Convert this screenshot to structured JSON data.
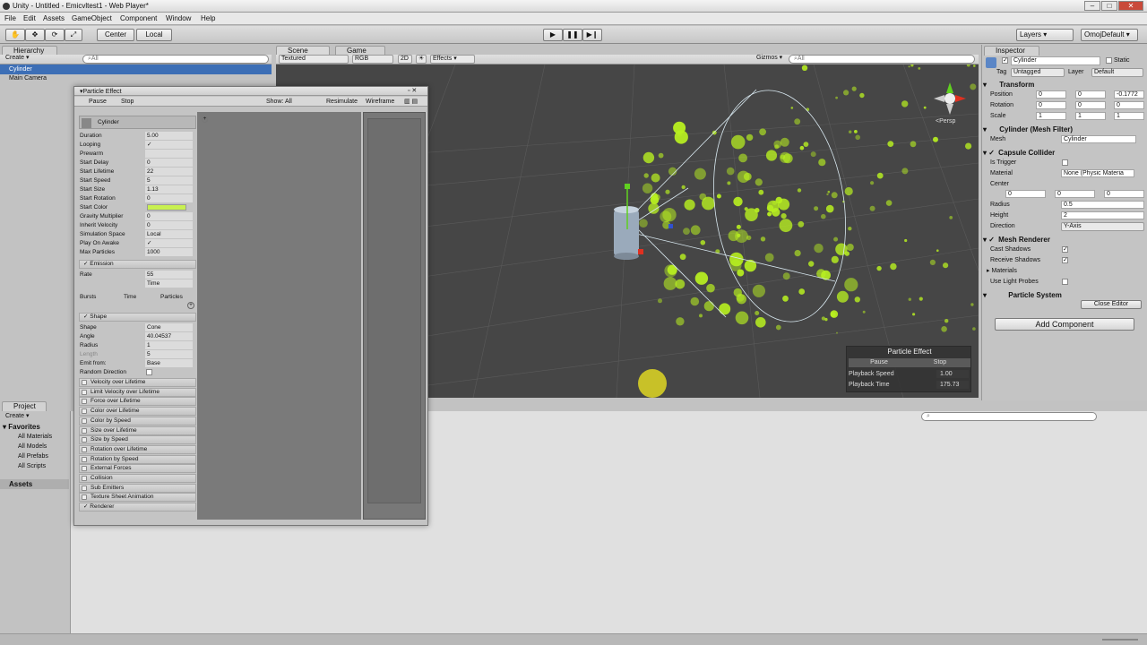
{
  "window": {
    "title": "Unity - Untitled - Emicvltest1 - Web Player*"
  },
  "menu": [
    "File",
    "Edit",
    "Assets",
    "GameObject",
    "Component",
    "Window",
    "Help"
  ],
  "toolbar": {
    "pivot": "Center",
    "space": "Local",
    "layers": "Layers",
    "layout": "OmojDefault"
  },
  "hierarchy": {
    "tab": "Hierarchy",
    "create": "Create",
    "search": "All",
    "items": [
      "Cylinder",
      "Main Camera"
    ]
  },
  "scene": {
    "tab_scene": "Scene",
    "tab_game": "Game",
    "render": "Textured",
    "color": "RGB",
    "mode2d": "2D",
    "effects": "Effects",
    "gizmos": "Gizmos",
    "search": "All",
    "persp": "Persp"
  },
  "overlay": {
    "title": "Particle Effect",
    "pause": "Pause",
    "stop": "Stop",
    "speed_label": "Playback Speed",
    "speed": "1.00",
    "time_label": "Playback Time",
    "time": "175.73"
  },
  "particle_effect": {
    "title": "Particle Effect",
    "pause": "Pause",
    "stop": "Stop",
    "show": "Show: All",
    "resimulate": "Resimulate",
    "wireframe": "Wireframe",
    "object": "Cylinder",
    "main": [
      {
        "label": "Duration",
        "value": "5.00"
      },
      {
        "label": "Looping",
        "value": "✓"
      },
      {
        "label": "Prewarm",
        "value": ""
      },
      {
        "label": "Start Delay",
        "value": "0"
      },
      {
        "label": "Start Lifetime",
        "value": "22"
      },
      {
        "label": "Start Speed",
        "value": "5"
      },
      {
        "label": "Start Size",
        "value": "1.13"
      },
      {
        "label": "Start Rotation",
        "value": "0"
      },
      {
        "label": "Start Color",
        "value": ""
      },
      {
        "label": "Gravity Multiplier",
        "value": "0"
      },
      {
        "label": "Inherit Velocity",
        "value": "0"
      },
      {
        "label": "Simulation Space",
        "value": "Local"
      },
      {
        "label": "Play On Awake",
        "value": "✓"
      },
      {
        "label": "Max Particles",
        "value": "1000"
      }
    ],
    "emission": {
      "label": "Emission",
      "rate_label": "Rate",
      "rate": "55",
      "rate_mode": "Time",
      "bursts": "Bursts",
      "time": "Time",
      "particles": "Particles"
    },
    "shape": {
      "label": "Shape",
      "rows": [
        {
          "label": "Shape",
          "value": "Cone"
        },
        {
          "label": "Angle",
          "value": "40.04537"
        },
        {
          "label": "Radius",
          "value": "1"
        },
        {
          "label": "Length",
          "value": "5"
        },
        {
          "label": "Emit from:",
          "value": "Base"
        },
        {
          "label": "Random Direction",
          "value": ""
        }
      ]
    },
    "modules": [
      "Velocity over Lifetime",
      "Limit Velocity over Lifetime",
      "Force over Lifetime",
      "Color over Lifetime",
      "Color by Speed",
      "Size over Lifetime",
      "Size by Speed",
      "Rotation over Lifetime",
      "Rotation by Speed",
      "External Forces",
      "Collision",
      "Sub Emitters",
      "Texture Sheet Animation"
    ],
    "renderer": "Renderer",
    "start_color": "#c8f050"
  },
  "project": {
    "tab": "Project",
    "create": "Create",
    "favorites": "Favorites",
    "items": [
      "All Materials",
      "All Models",
      "All Prefabs",
      "All Scripts"
    ],
    "assets": "Assets"
  },
  "inspector": {
    "tab": "Inspector",
    "name": "Cylinder",
    "static": "Static",
    "tag_label": "Tag",
    "tag": "Untagged",
    "layer_label": "Layer",
    "layer": "Default",
    "transform": {
      "title": "Transform",
      "position": [
        "0",
        "0",
        "-0.1772"
      ],
      "rotation": [
        "0",
        "0",
        "0"
      ],
      "scale": [
        "1",
        "1",
        "1"
      ],
      "pos_label": "Position",
      "rot_label": "Rotation",
      "scale_label": "Scale"
    },
    "mesh_filter": {
      "title": "Cylinder (Mesh Filter)",
      "mesh_label": "Mesh",
      "mesh": "Cylinder"
    },
    "collider": {
      "title": "Capsule Collider",
      "trigger": "Is Trigger",
      "material_label": "Material",
      "material": "None (Physic Materia",
      "center": "Center",
      "center_vals": [
        "0",
        "0",
        "0"
      ],
      "radius_label": "Radius",
      "radius": "0.5",
      "height_label": "Height",
      "height": "2",
      "direction_label": "Direction",
      "direction": "Y-Axis"
    },
    "renderer": {
      "title": "Mesh Renderer",
      "cast": "Cast Shadows",
      "receive": "Receive Shadows",
      "materials": "Materials",
      "probes": "Use Light Probes"
    },
    "particle": {
      "title": "Particle System",
      "close": "Close Editor"
    },
    "add_component": "Add Component"
  },
  "colors": {
    "particle": "#b8f020",
    "scene_bg": "#464646"
  }
}
